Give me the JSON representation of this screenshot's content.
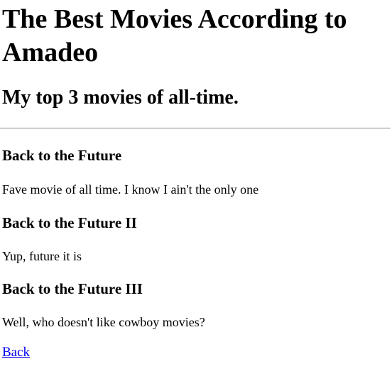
{
  "page": {
    "title": "The Best Movies According to Amadeo",
    "subtitle": "My top 3 movies of all-time."
  },
  "movies": [
    {
      "title": "Back to the Future",
      "description": "Fave movie of all time. I know I ain't the only one"
    },
    {
      "title": "Back to the Future II",
      "description": "Yup, future it is"
    },
    {
      "title": "Back to the Future III",
      "description": "Well, who doesn't like cowboy movies?"
    }
  ],
  "back_link": {
    "label": "Back"
  },
  "colors": {
    "link": "#0000ee",
    "text": "#000000",
    "divider": "#9a9a9a"
  }
}
